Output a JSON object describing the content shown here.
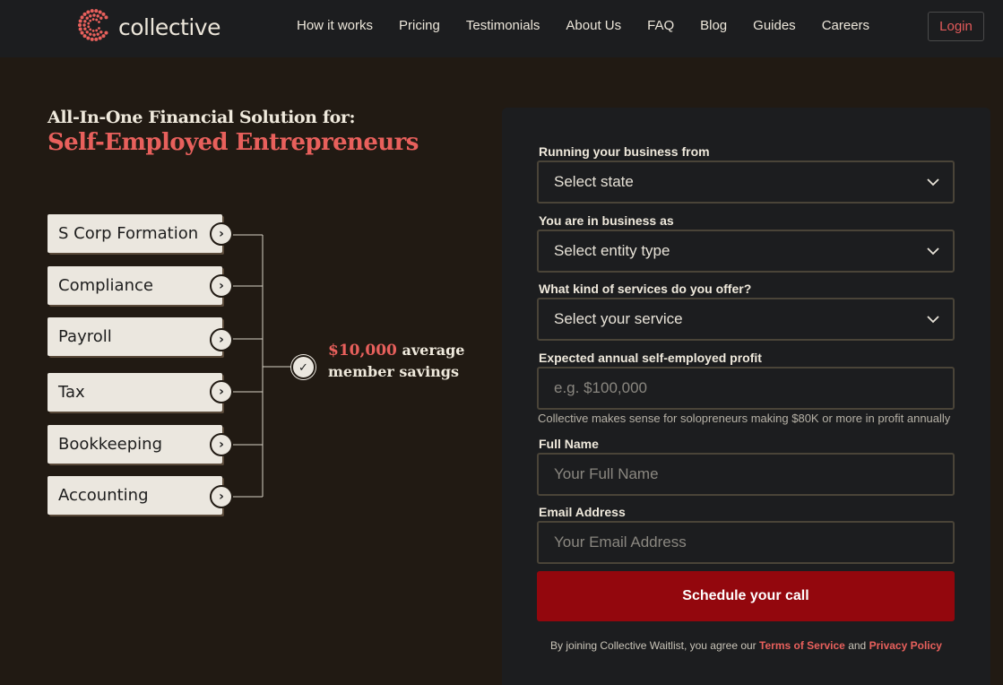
{
  "brand": {
    "name": "collective",
    "accent": "#e8605c",
    "logo_icon": "dotted-c-logo-icon"
  },
  "nav": {
    "links": [
      "How it works",
      "Pricing",
      "Testimonials",
      "About Us",
      "FAQ",
      "Blog",
      "Guides",
      "Careers"
    ],
    "login": "Login"
  },
  "hero": {
    "subtitle": "All-In-One Financial Solution for:",
    "title": "Self-Employed Entrepreneurs",
    "services": [
      "S Corp Formation",
      "Compliance",
      "Payroll",
      "Tax",
      "Bookkeeping",
      "Accounting"
    ],
    "savings_amount": "$10,000",
    "savings_text_1": "average",
    "savings_text_2": "member savings"
  },
  "form": {
    "state": {
      "label": "Running your business from",
      "value": "Select state"
    },
    "entity": {
      "label": "You are in business as",
      "value": "Select entity type"
    },
    "service": {
      "label": "What kind of services do you offer?",
      "value": "Select your service"
    },
    "profit": {
      "label": "Expected annual self-employed profit",
      "placeholder": "e.g. $100,000"
    },
    "profit_hint": "Collective makes sense for solopreneurs making $80K or more in profit annually",
    "name": {
      "label": "Full Name",
      "placeholder": "Your Full Name"
    },
    "email": {
      "label": "Email Address",
      "placeholder": "Your Email Address"
    },
    "submit": "Schedule your call",
    "legal_prefix": "By joining Collective Waitlist, you agree our",
    "terms": "Terms of Service",
    "and": "and",
    "privacy": "Privacy Policy"
  }
}
